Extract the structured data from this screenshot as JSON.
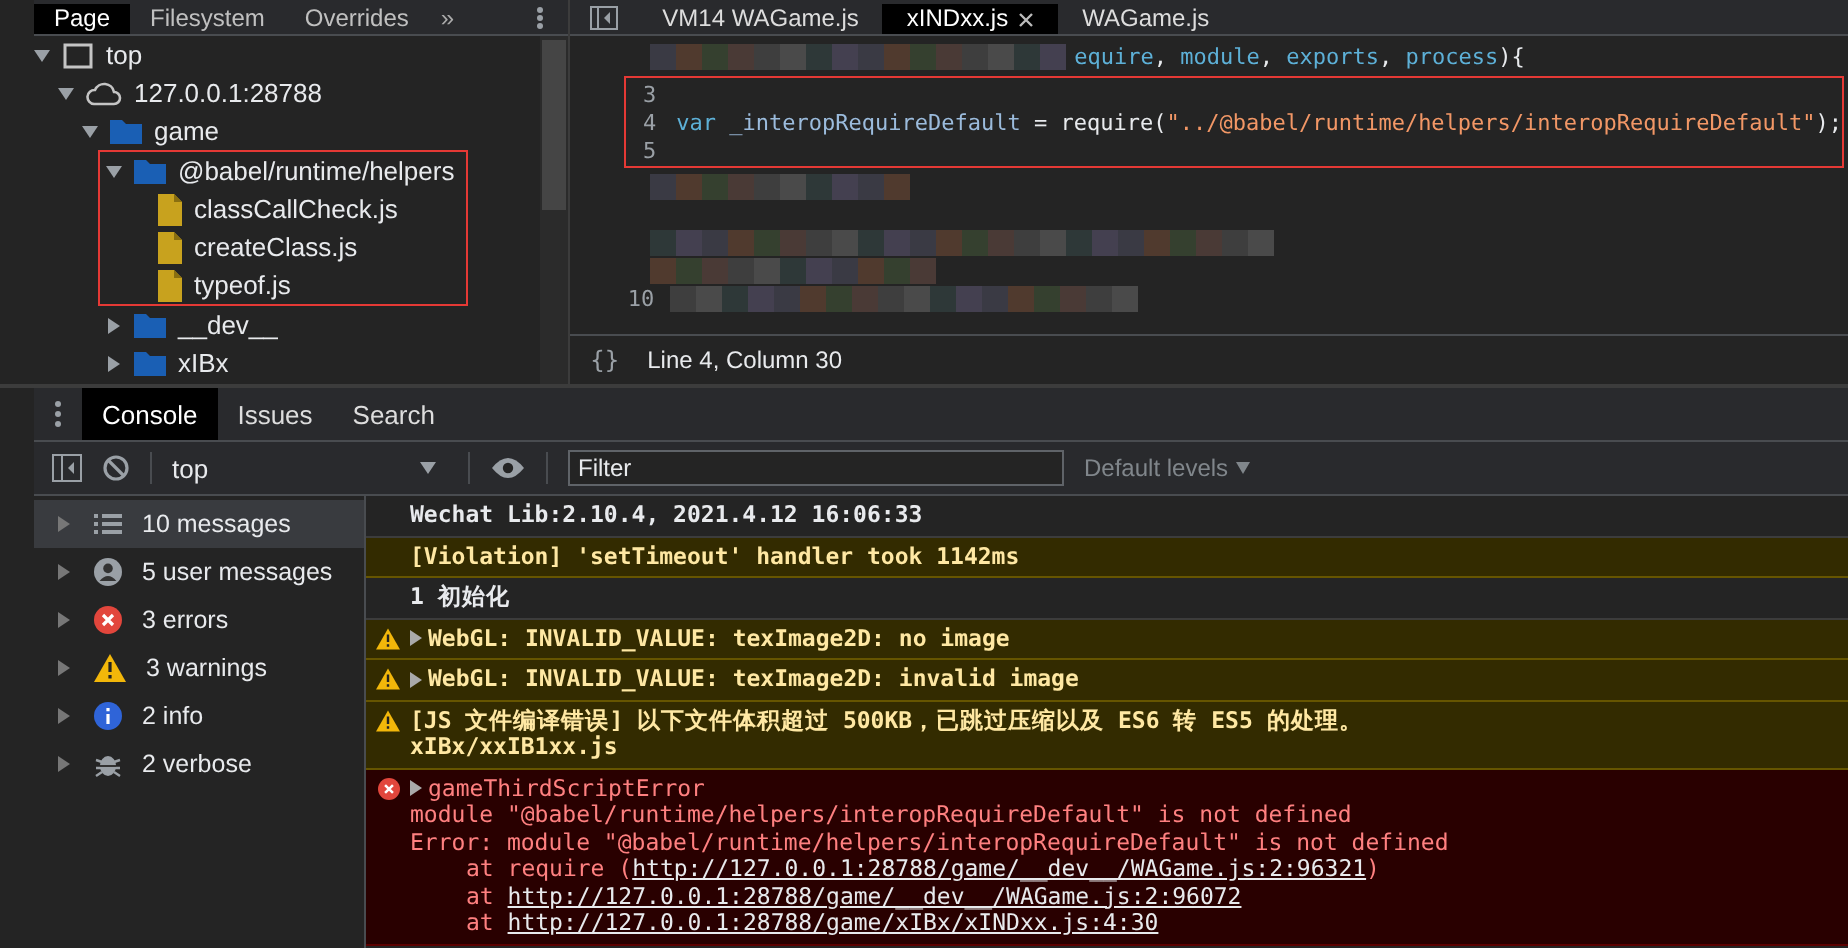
{
  "navigator": {
    "tabs": [
      {
        "label": "Page",
        "selected": true
      },
      {
        "label": "Filesystem",
        "selected": false
      },
      {
        "label": "Overrides",
        "selected": false
      }
    ],
    "more": "»",
    "tree": [
      {
        "kind": "frame",
        "label": "top",
        "expanded": true,
        "children": [
          {
            "kind": "origin",
            "label": "127.0.0.1:28788",
            "expanded": true,
            "children": [
              {
                "kind": "folder",
                "label": "game",
                "expanded": true,
                "children": [
                  {
                    "kind": "folder",
                    "label": "@babel/runtime/helpers",
                    "expanded": true,
                    "highlighted": true,
                    "children": [
                      {
                        "kind": "file",
                        "label": "classCallCheck.js"
                      },
                      {
                        "kind": "file",
                        "label": "createClass.js"
                      },
                      {
                        "kind": "file",
                        "label": "typeof.js"
                      }
                    ]
                  },
                  {
                    "kind": "folder",
                    "label": "__dev__",
                    "expanded": false
                  },
                  {
                    "kind": "folder",
                    "label": "xIBx",
                    "expanded": false
                  }
                ]
              }
            ]
          }
        ]
      }
    ]
  },
  "editor": {
    "tabs": [
      {
        "label": "VM14 WAGame.js",
        "selected": false,
        "closable": false
      },
      {
        "label": "xINDxx.js",
        "selected": true,
        "closable": true
      },
      {
        "label": "WAGame.js",
        "selected": false,
        "closable": false
      }
    ],
    "blocks": [
      {
        "highlighted": false,
        "lines": [
          {
            "blurred": true,
            "tokens": [
              {
                "kind": "param",
                "text": "equire"
              },
              {
                "kind": "plain",
                "text": ", "
              },
              {
                "kind": "param",
                "text": "module"
              },
              {
                "kind": "plain",
                "text": ", "
              },
              {
                "kind": "param",
                "text": "exports"
              },
              {
                "kind": "plain",
                "text": ", "
              },
              {
                "kind": "param",
                "text": "process"
              },
              {
                "kind": "plain",
                "text": "){"
              }
            ]
          }
        ]
      },
      {
        "highlighted": true,
        "lines": [
          {
            "number": "3",
            "blurred": false
          },
          {
            "number": "4",
            "blurred": false,
            "tokens": [
              {
                "kind": "keyword",
                "text": "var"
              },
              {
                "kind": "variable",
                "text": " _interopRequireDefault"
              },
              {
                "kind": "plain",
                "text": " = require("
              },
              {
                "kind": "string",
                "text": "\"../@babel/runtime/helpers/interopRequireDefault\""
              },
              {
                "kind": "plain",
                "text": ");"
              }
            ]
          },
          {
            "number": "5",
            "blurred": false
          }
        ]
      },
      {
        "highlighted": false,
        "lines": [
          {
            "blurred": true
          },
          {
            "blurred": false
          },
          {
            "blurred": true
          },
          {
            "blurred": true
          },
          {
            "number": "10",
            "blurred": true
          }
        ]
      }
    ],
    "status": {
      "icon": "{}",
      "position": "Line 4, Column 30"
    }
  },
  "console": {
    "tabs": [
      {
        "label": "Console",
        "selected": true
      },
      {
        "label": "Issues",
        "selected": false
      },
      {
        "label": "Search",
        "selected": false
      }
    ],
    "context": "top",
    "filter": {
      "placeholder": "Filter"
    },
    "levels": "Default levels",
    "sidebar": [
      {
        "kind": "messages",
        "label": "10 messages",
        "selected": true
      },
      {
        "kind": "user",
        "label": "5 user messages",
        "selected": false
      },
      {
        "kind": "error",
        "label": "3 errors",
        "selected": false
      },
      {
        "kind": "warning",
        "label": "3 warnings",
        "selected": false
      },
      {
        "kind": "info",
        "label": "2 info",
        "selected": false
      },
      {
        "kind": "verbose",
        "label": "2 verbose",
        "selected": false
      }
    ],
    "messages": [
      {
        "kind": "log",
        "expandable": false,
        "lines": [
          "Wechat Lib:2.10.4, 2021.4.12 16:06:33"
        ]
      },
      {
        "kind": "violation",
        "expandable": false,
        "lines": [
          "[Violation] 'setTimeout' handler took 1142ms"
        ]
      },
      {
        "kind": "log",
        "expandable": false,
        "lines": [
          "1 初始化"
        ]
      },
      {
        "kind": "warning",
        "expandable": true,
        "lines": [
          "WebGL: INVALID_VALUE: texImage2D: no image"
        ]
      },
      {
        "kind": "warning",
        "expandable": true,
        "lines": [
          "WebGL: INVALID_VALUE: texImage2D: invalid image"
        ]
      },
      {
        "kind": "warning",
        "expandable": false,
        "lines": [
          "[JS 文件编译错误] 以下文件体积超过 500KB，已跳过压缩以及 ES6 转 ES5 的处理。",
          "xIBx/xxIB1xx.js"
        ]
      },
      {
        "kind": "error",
        "expandable": true,
        "lines": [
          "gameThirdScriptError",
          "module \"@babel/runtime/helpers/interopRequireDefault\" is not defined",
          "Error: module \"@babel/runtime/helpers/interopRequireDefault\" is not defined"
        ],
        "stack": [
          {
            "prefix": "at require (",
            "link": "http://127.0.0.1:28788/game/__dev__/WAGame.js:2:96321",
            "suffix": ")"
          },
          {
            "prefix": "at ",
            "link": "http://127.0.0.1:28788/game/__dev__/WAGame.js:2:96072"
          },
          {
            "prefix": "at ",
            "link": "http://127.0.0.1:28788/game/xIBx/xINDxx.js:4:30"
          }
        ]
      }
    ]
  }
}
